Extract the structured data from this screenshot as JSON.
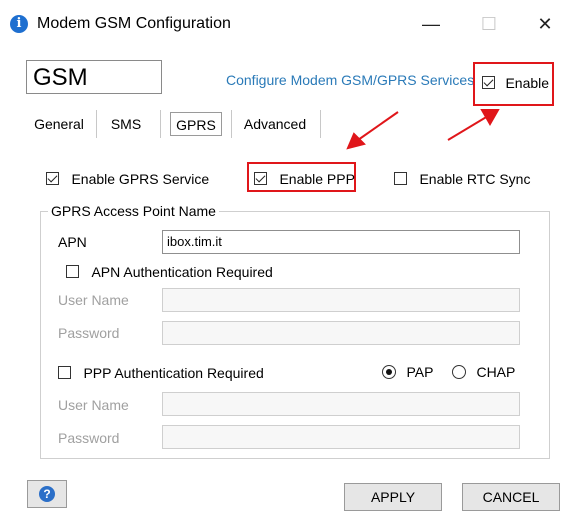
{
  "window": {
    "title": "Modem GSM Configuration",
    "minimize_glyph": "—",
    "maximize_glyph": "☐",
    "close_glyph": "✕"
  },
  "header": {
    "module_name": "GSM",
    "config_link": "Configure Modem GSM/GPRS Services",
    "enable_label": "Enable",
    "enable_checked": true
  },
  "tabs": [
    {
      "label": "General",
      "active": false
    },
    {
      "label": "SMS",
      "active": false
    },
    {
      "label": "GPRS",
      "active": true
    },
    {
      "label": "Advanced",
      "active": false
    }
  ],
  "options": {
    "enable_gprs_label": "Enable GPRS Service",
    "enable_gprs_checked": true,
    "enable_ppp_label": "Enable PPP",
    "enable_ppp_checked": true,
    "enable_rtc_label": "Enable RTC Sync",
    "enable_rtc_checked": false
  },
  "apn_group": {
    "legend": "GPRS Access Point Name",
    "apn_label": "APN",
    "apn_value": "ibox.tim.it",
    "apn_auth_label": "APN Authentication Required",
    "apn_auth_checked": false,
    "user_label": "User Name",
    "password_label": "Password",
    "ppp_auth_label": "PPP Authentication Required",
    "ppp_auth_checked": false,
    "pap_label": "PAP",
    "chap_label": "CHAP",
    "selected_protocol": "PAP",
    "user_label_2": "User Name",
    "password_label_2": "Password"
  },
  "footer": {
    "help_glyph": "?",
    "apply_label": "APPLY",
    "cancel_label": "CANCEL"
  },
  "colors": {
    "annotation_red": "#e0161a",
    "link_blue": "#2a7ab8",
    "info_blue": "#1e6fd0"
  }
}
